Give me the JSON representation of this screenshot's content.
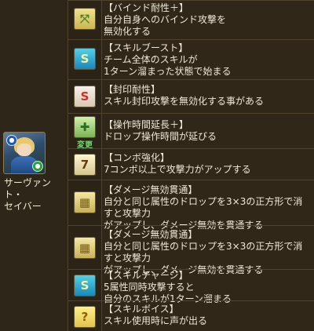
{
  "character": {
    "name_line1": "サーヴァント・",
    "name_line2": "セイバー"
  },
  "rows": [
    {
      "icon": "bind-resist-icon",
      "lines": [
        "【バインド耐性＋】",
        "自分自身へのバインド攻撃を",
        "無効化する"
      ]
    },
    {
      "icon": "skill-boost-icon",
      "lines": [
        "【スキルブースト】",
        "チーム全体のスキルが",
        "1ターン溜まった状態で始まる"
      ]
    },
    {
      "icon": "seal-resist-icon",
      "lines": [
        "【封印耐性】",
        "スキル封印攻撃を無効化する事がある"
      ]
    },
    {
      "icon": "time-extend-icon",
      "change_label": "変更",
      "lines": [
        "【操作時間延長＋】",
        "ドロップ操作時間が延びる"
      ]
    },
    {
      "icon": "combo-boost-icon",
      "lines": [
        "【コンボ強化】",
        "7コンボ以上で攻撃力がアップする"
      ]
    },
    {
      "icon": "damage-void-pierce-icon",
      "lines": [
        "【ダメージ無効貫通】",
        "自分と同じ属性のドロップを3×3の正方形で消すと攻撃力",
        "がアップし、ダメージ無効を貫通する"
      ]
    },
    {
      "icon": "damage-void-pierce-icon",
      "lines": [
        "【ダメージ無効貫通】",
        "自分と同じ属性のドロップを3×3の正方形で消すと攻撃力",
        "がアップし、ダメージ無効を貫通する"
      ]
    },
    {
      "icon": "skill-charge-icon",
      "lines": [
        "【スキルチャージ】",
        "5属性同時攻撃すると",
        "自分のスキルが1ターン溜まる"
      ]
    },
    {
      "icon": "skill-voice-icon",
      "lines": [
        "【スキルボイス】",
        "スキル使用時に声が出る"
      ]
    }
  ]
}
